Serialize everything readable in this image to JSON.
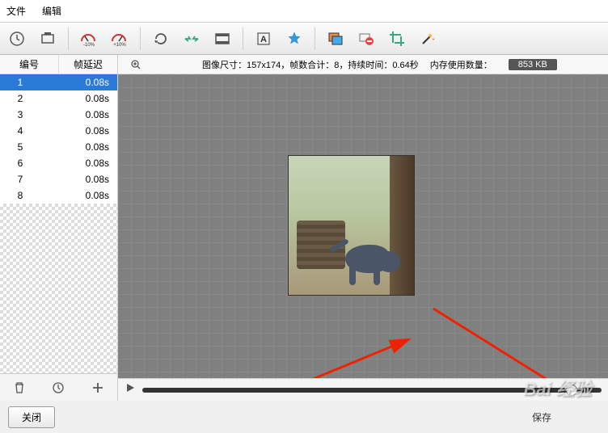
{
  "menu": {
    "file": "文件",
    "edit": "编辑"
  },
  "toolbar_icons": [
    "clock-icon",
    "screenshot-icon",
    "speed-down-icon",
    "speed-up-icon",
    "rotate-icon",
    "flip-icon",
    "frames-icon",
    "text-icon",
    "watermark-icon",
    "image-icon",
    "delete-frames-icon",
    "crop-icon",
    "effects-icon"
  ],
  "list": {
    "col1": "编号",
    "col2": "帧延迟",
    "frames": [
      {
        "n": "1",
        "d": "0.08s"
      },
      {
        "n": "2",
        "d": "0.08s"
      },
      {
        "n": "3",
        "d": "0.08s"
      },
      {
        "n": "4",
        "d": "0.08s"
      },
      {
        "n": "5",
        "d": "0.08s"
      },
      {
        "n": "6",
        "d": "0.08s"
      },
      {
        "n": "7",
        "d": "0.08s"
      },
      {
        "n": "8",
        "d": "0.08s"
      }
    ]
  },
  "info": {
    "text": "图像尺寸：157x174，帧数合计：8，持续时间：0.64秒",
    "mem_label": "内存使用数量：",
    "mem_value": "853 KB"
  },
  "buttons": {
    "close": "关闭",
    "save": "保存"
  },
  "watermark": "Bai 经验"
}
